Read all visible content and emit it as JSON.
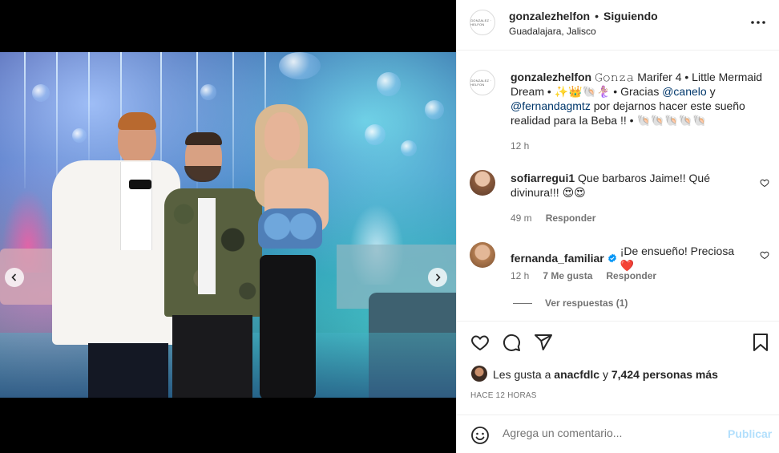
{
  "post": {
    "author": "gonzalezhelfon",
    "separator": "•",
    "follow_status": "Siguiendo",
    "location": "Guadalajara, Jalisco",
    "logo_text": "GONZALEZ · HELFON"
  },
  "caption": {
    "username": "gonzalezhelfon",
    "text_1": "𝙶𝚘𝚗𝚣𝚊 Marifer 4 • Little Mermaid Dream • ✨👑🐚🧜🏼‍♀️ • Gracias ",
    "mention_1": "@canelo",
    "text_2": " y ",
    "mention_2": "@fernandagmtz",
    "text_3": " por dejarnos hacer este sueño realidad para la Beba !! • 🐚🐚🐚🐚🐚",
    "time": "12 h"
  },
  "comments": [
    {
      "username": "sofiarregui1",
      "text": "Que barbaros Jaime!! Qué divinura!!! 😍😍",
      "time": "49 m",
      "reply_label": "Responder"
    },
    {
      "username": "fernanda_familiar",
      "verified": true,
      "text": "¡De ensueño! Preciosa ❤️",
      "time": "12 h",
      "likes": "7 Me gusta",
      "reply_label": "Responder",
      "view_replies": "Ver respuestas (1)"
    }
  ],
  "likes": {
    "prefix": "Les gusta a ",
    "user": "anacfdlc",
    "middle": " y ",
    "count": "7,424 personas más",
    "timestamp": "HACE 12 HORAS"
  },
  "add_comment": {
    "placeholder": "Agrega un comentario...",
    "publish_label": "Publicar"
  },
  "carousel": {
    "total": 10,
    "active_index": 8
  },
  "colors": {
    "link": "#00376b",
    "verified": "#0095f6",
    "publish_disabled": "#b2dffc",
    "secondary_text": "#737373"
  },
  "icons": [
    "more-options-icon",
    "heart-icon",
    "comment-icon",
    "share-icon",
    "bookmark-icon",
    "emoji-icon",
    "verified-badge-icon",
    "chevron-left-icon",
    "chevron-right-icon"
  ]
}
